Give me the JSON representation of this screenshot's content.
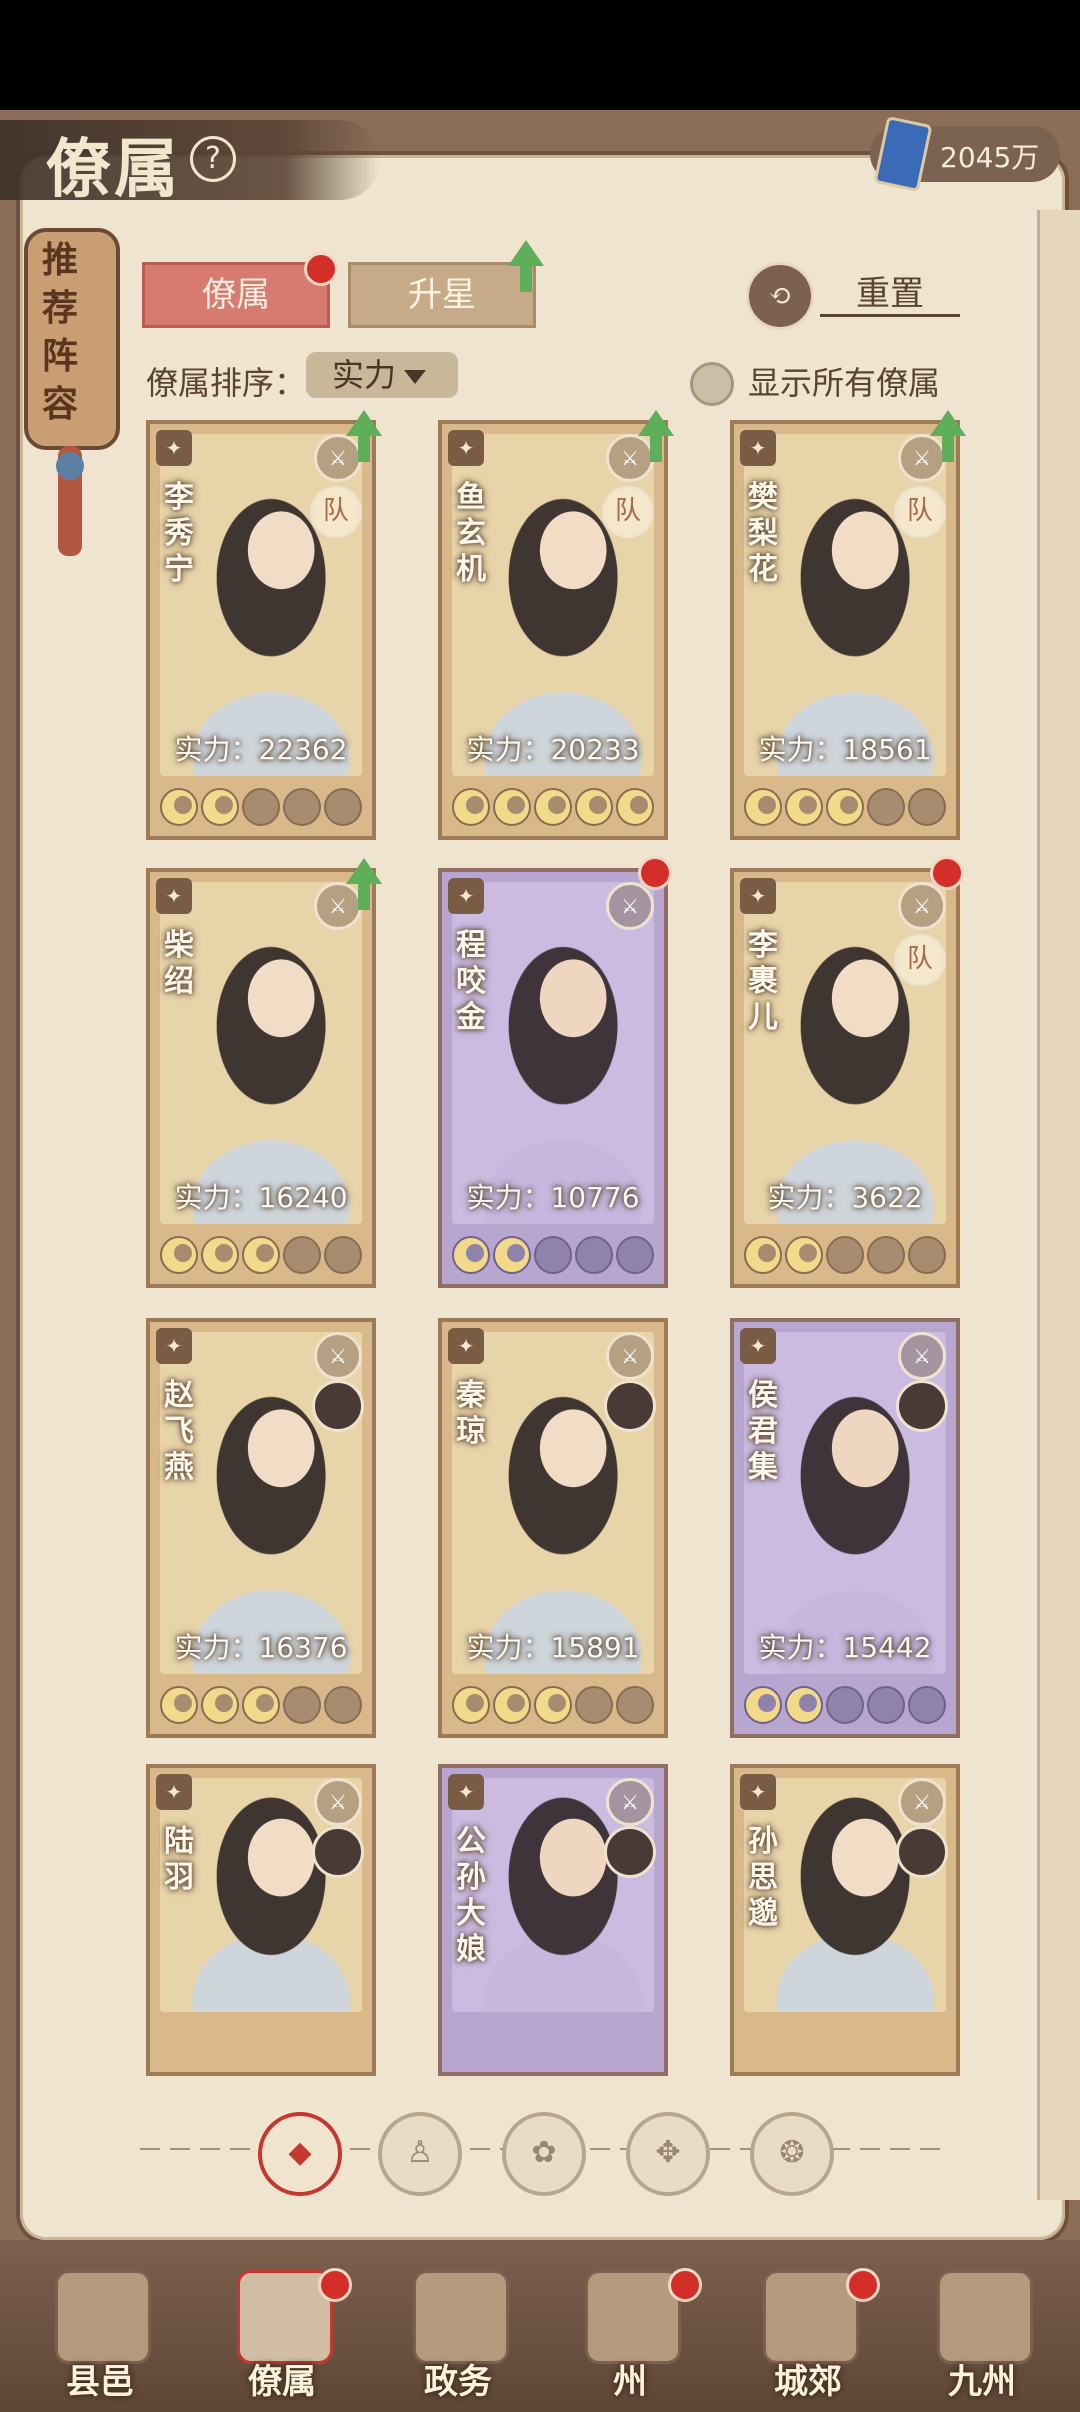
{
  "header": {
    "title": "僚属",
    "currency_value": "2045万"
  },
  "side_tag": {
    "label": "推荐阵容"
  },
  "tabs": [
    {
      "label": "僚属",
      "active": true,
      "badge": true
    },
    {
      "label": "升星",
      "active": false,
      "upgrade": true
    }
  ],
  "reset_label": "重置",
  "sort": {
    "label": "僚属排序：",
    "value": "实力"
  },
  "show_all_label": "显示所有僚属",
  "cards": [
    {
      "name": "李秀宁",
      "power": "实力：22362",
      "stars": 2,
      "style": "gold",
      "team": "队",
      "up": true
    },
    {
      "name": "鱼玄机",
      "power": "实力：20233",
      "stars": 5,
      "style": "gold",
      "team": "队",
      "up": true
    },
    {
      "name": "樊梨花",
      "power": "实力：18561",
      "stars": 3,
      "style": "gold",
      "team": "队",
      "up": true
    },
    {
      "name": "柴绍",
      "power": "实力：16240",
      "stars": 3,
      "style": "gold",
      "team": "",
      "up": true
    },
    {
      "name": "程咬金",
      "power": "实力：10776",
      "stars": 2,
      "style": "purple",
      "team": "",
      "dot": true
    },
    {
      "name": "李裹儿",
      "power": "实力：3622",
      "stars": 2,
      "style": "gold",
      "team": "队",
      "dot": true
    },
    {
      "name": "赵飞燕",
      "power": "实力：16376",
      "stars": 3,
      "style": "gold",
      "portrait": true
    },
    {
      "name": "秦琼",
      "power": "实力：15891",
      "stars": 3,
      "style": "gold",
      "portrait": true
    },
    {
      "name": "侯君集",
      "power": "实力：15442",
      "stars": 2,
      "style": "purple",
      "portrait": true
    },
    {
      "name": "陆羽",
      "power": "",
      "stars": 0,
      "style": "gold",
      "portrait": true
    },
    {
      "name": "公孙大娘",
      "power": "",
      "stars": 0,
      "style": "purple",
      "portrait": true
    },
    {
      "name": "孙思邈",
      "power": "",
      "stars": 0,
      "style": "gold",
      "portrait": true
    }
  ],
  "filters": [
    {
      "icon": "all-filter-icon",
      "active": true
    },
    {
      "icon": "scholar-filter-icon",
      "active": false
    },
    {
      "icon": "beast-filter-icon",
      "active": false
    },
    {
      "icon": "fan-filter-icon",
      "active": false
    },
    {
      "icon": "dragon-filter-icon",
      "active": false
    }
  ],
  "bottom_nav": [
    {
      "label": "县邑",
      "active": false,
      "badge": false
    },
    {
      "label": "僚属",
      "active": true,
      "badge": true
    },
    {
      "label": "政务",
      "active": false,
      "badge": false
    },
    {
      "label": "州",
      "active": false,
      "badge": true
    },
    {
      "label": "城郊",
      "active": false,
      "badge": true
    },
    {
      "label": "九州",
      "active": false,
      "badge": false
    }
  ],
  "colors": {
    "accent_red": "#d42e28",
    "paper": "#efe4cf",
    "upgrade_green": "#5fae5a"
  }
}
